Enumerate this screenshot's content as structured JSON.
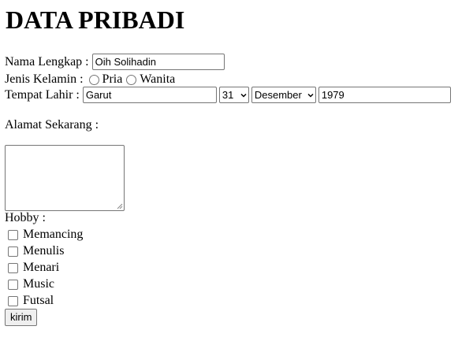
{
  "page_title": "DATA PRIBADI",
  "form": {
    "nama": {
      "label": "Nama Lengkap :",
      "value": "Oih Solihadin"
    },
    "jenis_kelamin": {
      "label": "Jenis Kelamin :",
      "options": [
        "Pria",
        "Wanita"
      ],
      "selected": null
    },
    "tempat_lahir": {
      "label": "Tempat Lahir :",
      "place": "Garut",
      "day": "31",
      "month": "Desember",
      "year": "1979"
    },
    "alamat": {
      "label": "Alamat Sekarang :",
      "value": ""
    },
    "hobby": {
      "label": "Hobby :",
      "items": [
        "Memancing",
        "Menulis",
        "Menari",
        "Music",
        "Futsal"
      ],
      "checked": [
        false,
        false,
        false,
        false,
        false
      ]
    },
    "submit_label": "kirim"
  },
  "icons": {
    "select_arrow": "chevron-down-icon",
    "textarea_resize": "resize-grip-icon"
  }
}
